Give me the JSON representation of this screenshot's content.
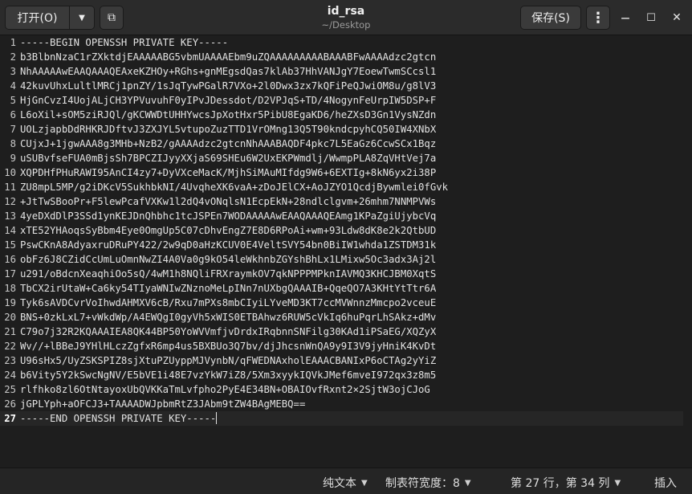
{
  "window": {
    "title": "id_rsa",
    "subtitle": "~/Desktop"
  },
  "toolbar": {
    "open_label": "打开(O)",
    "save_label": "保存(S)",
    "dropdown_glyph": "▼",
    "newtab_glyph": "⧉",
    "menu_glyph": "⋮",
    "minimize_glyph": "—",
    "maximize_glyph": "☐",
    "close_glyph": "✕"
  },
  "editor": {
    "current_line": 27,
    "lines": [
      {
        "n": "1",
        "text": "-----BEGIN OPENSSH PRIVATE KEY-----"
      },
      {
        "n": "2",
        "text": "b3BlbnNzaC1rZXktdjEAAAAABG5vbmUAAAAEbm9uZQAAAAAAAAABAAABFwAAAAdzc2gtcn"
      },
      {
        "n": "3",
        "text": "NhAAAAAwEAAQAAAQEAxeKZHOy+RGhs+gnMEgsdQas7klAb37HhVANJgY7EoewTwmSCcsl1"
      },
      {
        "n": "4",
        "text": "42kuvUhxLultlMRCj1pnZY/1sJqTywPGalR7VXo+2l0Dwx3zx7kQFiPeQJwiOM8u/g8lV3"
      },
      {
        "n": "5",
        "text": "HjGnCvzI4UojALjCH3YPVuvuhF0yIPvJDessdot/D2VPJqS+TD/4NogynFeUrpIW5DSP+F"
      },
      {
        "n": "6",
        "text": "L6oXil+sOM5ziRJQl/gKCWWDtUHHYwcsJpXotHxr5PibU8EgaKD6/heZXsD3Gn1VysNZdn"
      },
      {
        "n": "7",
        "text": "UOLzjapbDdRHKRJDftvJ3ZXJYL5vtupoZuzTTD1VrOMng13Q5T90kndcpyhCQ50IW4XNbX"
      },
      {
        "n": "8",
        "text": "CUjxJ+1jgwAAA8g3MHb+NzB2/gAAAAdzc2gtcnNhAAABAQDF4pkc7L5EaGz6CcwSCx1Bqz"
      },
      {
        "n": "9",
        "text": "uSUBvfseFUA0mBjsSh7BPCZIJyyXXjaS69SHEu6W2UxEKPWmdlj/WwmpPLA8ZqVHtVej7a"
      },
      {
        "n": "10",
        "text": "XQPDHfPHuRAWI95AnCI4zy7+DyVXceMacK/MjhSiMAuMIfdg9W6+6EXTIg+8kN6yx2i38P"
      },
      {
        "n": "11",
        "text": "ZU8mpL5MP/g2iDKcV5SukhbkNI/4UvqheXK6vaA+zDoJElCX+AoJZYO1QcdjBywmlei0fGvk"
      },
      {
        "n": "12",
        "text": "+JtTwSBooPr+F5lewPcafVXKw1l2dQ4vONqlsN1EcpEkN+28ndlclgvm+26mhm7NNMPVWs"
      },
      {
        "n": "13",
        "text": "4yeDXdDlP3SSd1ynKEJDnQhbhc1tcJSPEn7WODAAAAAwEAAQAAAQEAmg1KPaZgiUjybcVq"
      },
      {
        "n": "14",
        "text": "xTE52YHAoqsSyBbm4Eye0OmgUp5C07cDhvEngZ7E8D6RPoAi+wm+93Ldw8dK8e2k2QtbUD"
      },
      {
        "n": "15",
        "text": "PswCKnA8AdyaxruDRuPY422/2w9qD0aHzKCUV0E4VeltSVY54bn0BiIW1whda1ZSTDM31k"
      },
      {
        "n": "16",
        "text": "obFz6J8CZidCcUmLuOmnNwZI4A0Va0g9kO54leWkhnbZGYshBhLx1LMixw5Oc3adx3Aj2l"
      },
      {
        "n": "17",
        "text": "u291/oBdcnXeaqhiOo5sQ/4wM1h8NQliFRXraymkOV7qkNPPPMPknIAVMQ3KHCJBM0XqtS"
      },
      {
        "n": "18",
        "text": "TbCX2irUtaW+Ca6ky54TIyaWNIwZNznoMeLpINn7nUXbgQAAAIB+QqeQO7A3KHtYtTtr6A"
      },
      {
        "n": "19",
        "text": "Tyk6sAVDCvrVoIhwdAHMXV6cB/Rxu7mPXs8mbCIyiLYveMD3KT7ccMVWnnzMmcpo2vceuE"
      },
      {
        "n": "20",
        "text": "BNS+0zkLxL7+vWkdWp/A4EWQgI0gyVh5xWIS0ETBAhwz6RUW5cVkIq6huPqrLhSAkz+dMv"
      },
      {
        "n": "21",
        "text": "C79o7j32R2KQAAAIEA8QK44BP50YoWVVmfjvDrdxIRqbnnSNFilg30KAd1iPSaEG/XQZyX"
      },
      {
        "n": "22",
        "text": "Wv//+lBBeJ9YHlHLczZgfxR6mp4us5BXBUo3Q7bv/djJhcsnWnQA9y9I3V9jyHniK4KvDt"
      },
      {
        "n": "23",
        "text": "U96sHx5/UyZSKSPIZ8sjXtuPZUyppMJVynbN/qFWEDNAxholEAAACBANIxP6oCTAg2yYiZ"
      },
      {
        "n": "24",
        "text": "b6Vity5Y2kSwcNgNV/E5bVE1i48E7vzYkW7iZ8/5Xm3xyykIQVkJMef6mveI972qx3z8m5"
      },
      {
        "n": "25",
        "text": "rlfhko8zl6OtNtayoxUbQVKKaTmLvfpho2PyE4E34BN+OBAIOvfRxnt2×2SjtW3ojCJoG"
      },
      {
        "n": "26",
        "text": "jGPLYph+aOFCJ3+TAAAADWJpbmRtZ3JAbm9tZW4BAgMEBQ=="
      },
      {
        "n": "27",
        "text": "-----END OPENSSH PRIVATE KEY-----"
      }
    ]
  },
  "status": {
    "language": "纯文本",
    "tab_width": "制表符宽度：8",
    "position": "第 27 行，第 34 列",
    "mode": "插入",
    "dropdown_glyph": "▼"
  }
}
